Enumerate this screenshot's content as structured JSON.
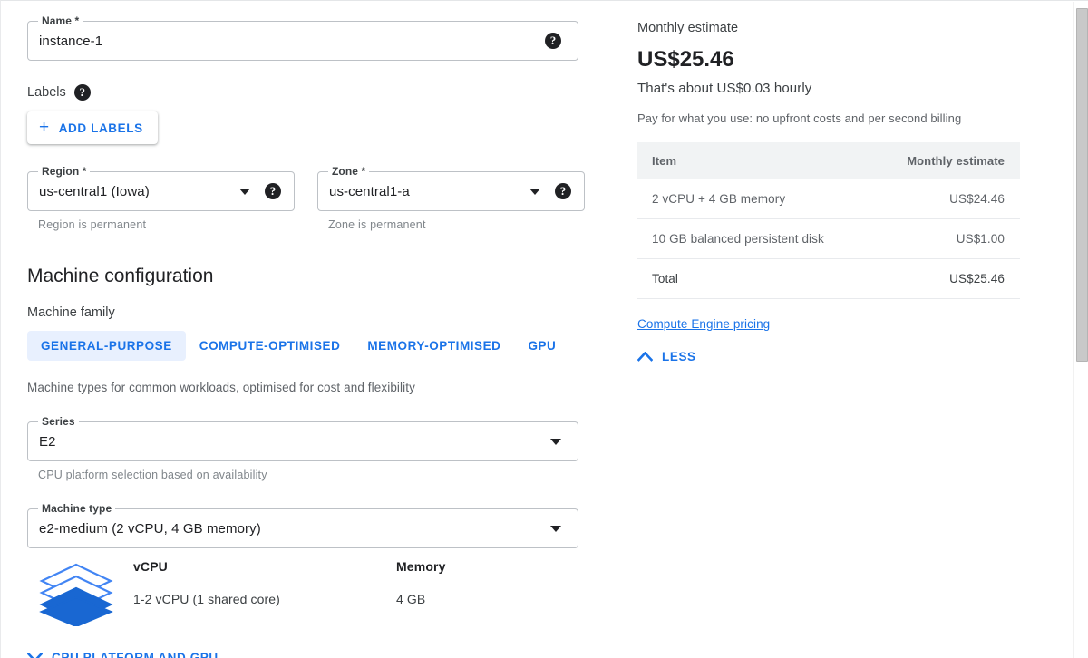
{
  "form": {
    "name": {
      "legend": "Name *",
      "value": "instance-1",
      "help_icon": "help-icon"
    },
    "labels": {
      "label": "Labels",
      "help_icon": "help-icon",
      "add_button": "ADD LABELS",
      "plus_icon": "plus-icon"
    },
    "region": {
      "legend": "Region *",
      "value": "us-central1 (Iowa)",
      "hint": "Region is permanent",
      "caret_icon": "chevron-down-icon",
      "help_icon": "help-icon"
    },
    "zone": {
      "legend": "Zone *",
      "value": "us-central1-a",
      "hint": "Zone is permanent",
      "caret_icon": "chevron-down-icon",
      "help_icon": "help-icon"
    },
    "machine_configuration": {
      "title": "Machine configuration",
      "family_label": "Machine family",
      "tabs": [
        {
          "label": "GENERAL-PURPOSE",
          "active": true
        },
        {
          "label": "COMPUTE-OPTIMISED",
          "active": false
        },
        {
          "label": "MEMORY-OPTIMISED",
          "active": false
        },
        {
          "label": "GPU",
          "active": false
        }
      ],
      "family_description": "Machine types for common workloads, optimised for cost and flexibility",
      "series": {
        "legend": "Series",
        "value": "E2",
        "hint": "CPU platform selection based on availability",
        "caret_icon": "chevron-down-icon"
      },
      "machine_type": {
        "legend": "Machine type",
        "value": "e2-medium (2 vCPU, 4 GB memory)",
        "caret_icon": "chevron-down-icon"
      },
      "specs": {
        "stack_icon": "disk-stack-icon",
        "vcpu_title": "vCPU",
        "vcpu_value": "1-2 vCPU (1 shared core)",
        "memory_title": "Memory",
        "memory_value": "4 GB"
      },
      "cpu_platform_expander": {
        "label": "CPU PLATFORM AND GPU",
        "icon": "chevron-down-icon"
      }
    }
  },
  "estimate_panel": {
    "title": "Monthly estimate",
    "amount": "US$25.46",
    "hourly": "That's about US$0.03 hourly",
    "note": "Pay for what you use: no upfront costs and per second billing",
    "table": {
      "headers": [
        "Item",
        "Monthly estimate"
      ],
      "rows": [
        {
          "item": "2 vCPU + 4 GB memory",
          "cost": "US$24.46"
        },
        {
          "item": "10 GB balanced persistent disk",
          "cost": "US$1.00"
        },
        {
          "item": "Total",
          "cost": "US$25.46"
        }
      ]
    },
    "pricing_link": "Compute Engine pricing",
    "less_button": {
      "label": "LESS",
      "icon": "chevron-up-icon"
    }
  },
  "colors": {
    "accent": "#1a73e8",
    "tab_active_bg": "#e8f0fe",
    "table_header_bg": "#f1f3f4",
    "text_primary": "#202124",
    "text_secondary": "#5f6368"
  },
  "scrollbar": {
    "vertical": "vertical-scrollbar"
  }
}
